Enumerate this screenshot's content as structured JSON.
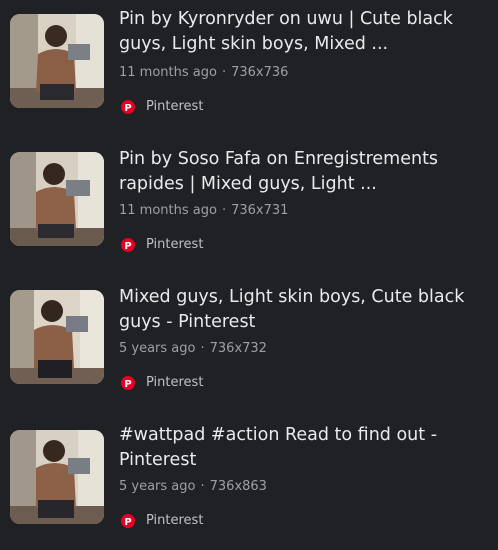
{
  "results": [
    {
      "title_line1": "Pin by Kyronryder on uwu | Cute black",
      "title_line2": "guys, Light skin boys, Mixed ...",
      "age": "11 months ago",
      "dims": "736x736",
      "source": "Pinterest"
    },
    {
      "title_line1": "Pin by Soso Fafa on Enregistrements",
      "title_line2": "rapides | Mixed guys, Light ...",
      "age": "11 months ago",
      "dims": "736x731",
      "source": "Pinterest"
    },
    {
      "title_line1": "Mixed guys, Light skin boys, Cute black",
      "title_line2": "guys - Pinterest",
      "age": "5 years ago",
      "dims": "736x732",
      "source": "Pinterest"
    },
    {
      "title_line1": "#wattpad #action Read to find out -",
      "title_line2": "Pinterest",
      "age": "5 years ago",
      "dims": "736x863",
      "source": "Pinterest"
    }
  ],
  "meta_separator": "·",
  "source_icon": "pinterest-icon",
  "colors": {
    "background": "#202124",
    "title": "#e8eaed",
    "meta": "#9aa0a6",
    "pinterest": "#e60023"
  }
}
